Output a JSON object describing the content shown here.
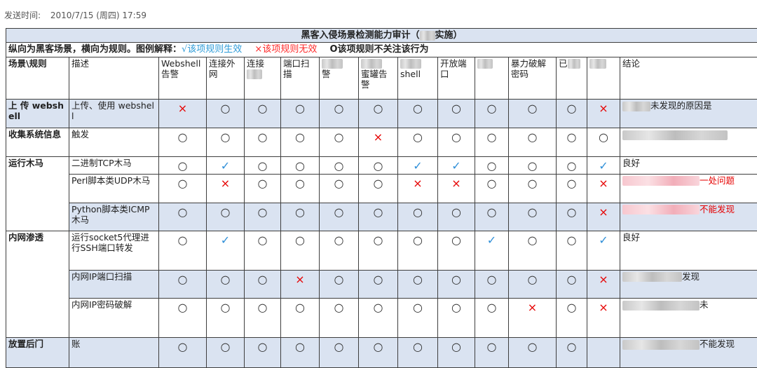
{
  "send_time": {
    "label": "发送时间:",
    "value": "2010/7/15 (周四) 17:59"
  },
  "table": {
    "title_prefix": "黑客入侵场景检测能力审计（",
    "title_suffix": "实施）",
    "legend": {
      "prefix": "纵向为黑客场景，横向为规则。图例解释：",
      "ok": "√该项规则生效",
      "bad": "×该项规则无效",
      "na": "O该项规则不关注该行为"
    },
    "headers": {
      "scene": "场景\\规则",
      "desc": "描述",
      "webshell": "Webshell告警",
      "conn_out": "连接外网",
      "conn2": "连接",
      "port_scan": "端口扫描",
      "c5_tail": "警",
      "honeypot": "蜜罐告警",
      "shell": "shell",
      "open_port": "开放端口",
      "bruteforce": "暴力破解密码",
      "clear": "已",
      "conclusion": "结论"
    },
    "symbols": {
      "ok": "✓",
      "bad": "×",
      "na": "○"
    },
    "colors": {
      "ok": "#2f8fd8",
      "bad": "#e60000",
      "highlight": "#dae3f1"
    },
    "rows": [
      {
        "scene": "上 传 webshell",
        "scene_show": true,
        "desc": "上传、使用 webshell",
        "marks": [
          "bad",
          "na",
          "na",
          "na",
          "na",
          "na",
          "na",
          "na",
          "na",
          "na",
          "na",
          "bad"
        ],
        "conclusion": "未发现的原因是",
        "conclusion_red": false,
        "hl": true
      },
      {
        "scene": "收集系统信息",
        "scene_show": true,
        "desc": "触发",
        "marks": [
          "na",
          "na",
          "na",
          "na",
          "na",
          "bad",
          "na",
          "na",
          "na",
          "na",
          "na",
          "na"
        ],
        "conclusion": "",
        "conclusion_red": false,
        "hl": false
      },
      {
        "scene": "运行木马",
        "scene_show": true,
        "desc": "二进制TCP木马",
        "marks": [
          "na",
          "ok",
          "na",
          "na",
          "na",
          "na",
          "ok",
          "ok",
          "na",
          "na",
          "na",
          "ok"
        ],
        "conclusion": "良好",
        "conclusion_red": false,
        "hl": false
      },
      {
        "scene": "",
        "scene_show": false,
        "desc": "Perl脚本类UDP木马",
        "marks": [
          "na",
          "bad",
          "na",
          "na",
          "na",
          "na",
          "bad",
          "bad",
          "na",
          "na",
          "na",
          "bad"
        ],
        "conclusion": "一处问题",
        "conclusion_red": true,
        "hl": false
      },
      {
        "scene": "",
        "scene_show": false,
        "desc": "Python脚本类ICMP木马",
        "marks": [
          "na",
          "na",
          "na",
          "na",
          "na",
          "na",
          "na",
          "na",
          "na",
          "na",
          "na",
          "bad"
        ],
        "conclusion": "不能发现",
        "conclusion_red": true,
        "hl": true
      },
      {
        "scene": "内网渗透",
        "scene_show": true,
        "desc": "运行socket5代理进行SSH端口转发",
        "marks": [
          "na",
          "ok",
          "na",
          "na",
          "na",
          "na",
          "na",
          "na",
          "ok",
          "na",
          "na",
          "ok"
        ],
        "conclusion": "良好",
        "conclusion_red": false,
        "hl": false
      },
      {
        "scene": "",
        "scene_show": false,
        "desc": "内网IP端口扫描",
        "marks": [
          "na",
          "na",
          "na",
          "bad",
          "na",
          "na",
          "na",
          "na",
          "na",
          "na",
          "na",
          "bad"
        ],
        "conclusion": "发现",
        "conclusion_red": false,
        "hl": true
      },
      {
        "scene": "",
        "scene_show": false,
        "desc": "内网IP密码破解",
        "marks": [
          "na",
          "na",
          "na",
          "na",
          "na",
          "na",
          "na",
          "na",
          "na",
          "bad",
          "na",
          "bad"
        ],
        "conclusion": "未",
        "conclusion_red": false,
        "hl": false
      },
      {
        "scene": "放置后门",
        "scene_show": true,
        "desc": "账",
        "marks": [
          "na",
          "na",
          "na",
          "na",
          "na",
          "na",
          "na",
          "na",
          "na",
          "na",
          "na",
          ""
        ],
        "conclusion": "不能发现",
        "conclusion_red": false,
        "hl": true
      }
    ]
  }
}
